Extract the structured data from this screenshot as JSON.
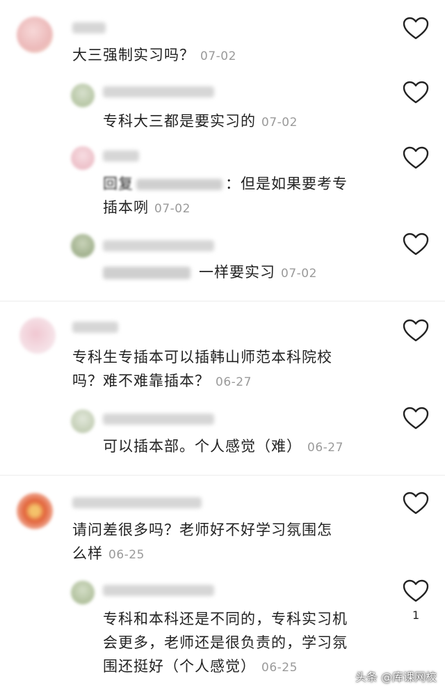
{
  "comments": [
    {
      "text": "大三强制实习吗？",
      "date": "07-02",
      "avatar_color": "#f0c6c6",
      "replies": [
        {
          "text": "专科大三都是要实习的",
          "date": "07-02",
          "avatar_color": "#b9c9a8"
        },
        {
          "prefix": "回复",
          "text": "：但是如果要考专",
          "text2": "插本咧",
          "date": "07-02",
          "avatar_color": "#f2c8cf"
        },
        {
          "text": "一样要实习",
          "date": "07-02",
          "avatar_color": "#9fb08a"
        }
      ]
    },
    {
      "text": "专科生专插本可以插韩山师范本科院校",
      "text2": "吗？难不难靠插本？",
      "date": "06-27",
      "avatar_color": "#e8b6c2",
      "replies": [
        {
          "text": "可以插本部。个人感觉（难）",
          "date": "06-27",
          "avatar_color": "#c8d3bf"
        }
      ]
    },
    {
      "text": "请问差很多吗？老师好不好学习氛围怎",
      "text2": "么样",
      "date": "06-25",
      "avatar_color": "#e06a3b",
      "replies": [
        {
          "text": "专科和本科还是不同的，专科实习机",
          "text2": "会更多，老师还是很负责的，学习氛",
          "text3": "围还挺好（个人感觉）",
          "date": "06-25",
          "avatar_color": "#aebf98",
          "likes": "1"
        }
      ]
    }
  ],
  "watermark": "头条 @库课网校",
  "icons": {
    "like": "heart-outline-icon"
  }
}
